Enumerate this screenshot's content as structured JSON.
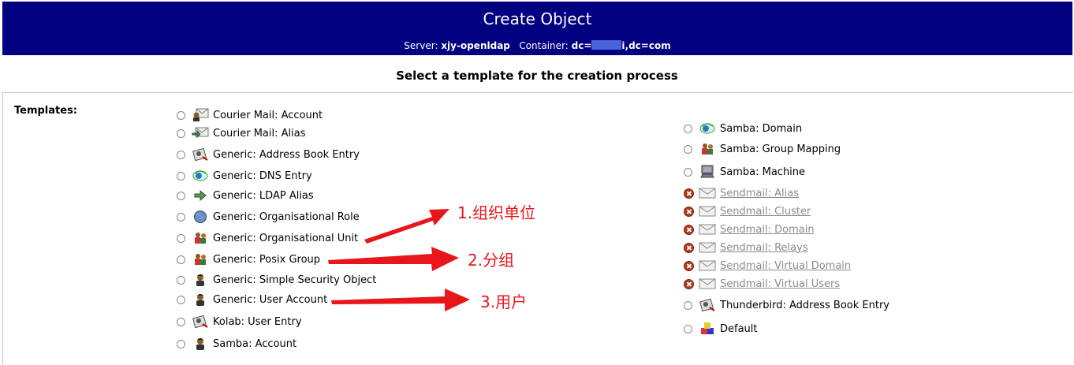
{
  "header": {
    "title": "Create Object",
    "server_label": "Server:",
    "server_value": "xjy-openldap",
    "container_label": "Container:",
    "container_prefix": "dc=",
    "container_suffix": "i,dc=com"
  },
  "subtitle": "Select a template for the creation process",
  "templates_label": "Templates:",
  "left_templates": [
    {
      "label": "Courier Mail: Account",
      "icon": "mail-user-icon",
      "state": "enabled"
    },
    {
      "label": "Courier Mail: Alias",
      "icon": "mail-forward-icon",
      "state": "enabled"
    },
    {
      "label": "Generic: Address Book Entry",
      "icon": "address-book-icon",
      "state": "enabled"
    },
    {
      "label": "Generic: DNS Entry",
      "icon": "dns-icon",
      "state": "enabled"
    },
    {
      "label": "Generic: LDAP Alias",
      "icon": "arrow-right-icon",
      "state": "enabled"
    },
    {
      "label": "Generic: Organisational Role",
      "icon": "globe-icon",
      "state": "enabled"
    },
    {
      "label": "Generic: Organisational Unit",
      "icon": "group-icon",
      "state": "enabled"
    },
    {
      "label": "Generic: Posix Group",
      "icon": "group-icon",
      "state": "enabled"
    },
    {
      "label": "Generic: Simple Security Object",
      "icon": "user-icon",
      "state": "enabled"
    },
    {
      "label": "Generic: User Account",
      "icon": "user-icon",
      "state": "enabled"
    },
    {
      "label": "Kolab: User Entry",
      "icon": "address-book-icon",
      "state": "enabled"
    },
    {
      "label": "Samba: Account",
      "icon": "user-icon",
      "state": "enabled"
    }
  ],
  "right_templates": [
    {
      "label": "Samba: Domain",
      "icon": "dns-icon",
      "state": "enabled"
    },
    {
      "label": "Samba: Group Mapping",
      "icon": "group-icon",
      "state": "enabled"
    },
    {
      "label": "Samba: Machine",
      "icon": "computer-icon",
      "state": "enabled"
    },
    {
      "label": "Sendmail: Alias",
      "icon": "envelope-icon",
      "state": "disabled"
    },
    {
      "label": "Sendmail: Cluster",
      "icon": "envelope-icon",
      "state": "disabled"
    },
    {
      "label": "Sendmail: Domain",
      "icon": "envelope-icon",
      "state": "disabled"
    },
    {
      "label": "Sendmail: Relays",
      "icon": "envelope-icon",
      "state": "disabled"
    },
    {
      "label": "Sendmail: Virtual Domain",
      "icon": "envelope-icon",
      "state": "disabled"
    },
    {
      "label": "Sendmail: Virtual Users",
      "icon": "envelope-icon",
      "state": "disabled"
    },
    {
      "label": "Thunderbird: Address Book Entry",
      "icon": "address-book-icon",
      "state": "enabled"
    },
    {
      "label": "Default",
      "icon": "default-object-icon",
      "state": "enabled"
    }
  ],
  "annotations": [
    "1.组织单位",
    "2.分组",
    "3.用户"
  ],
  "colors": {
    "header_bg": "#000080",
    "annotation": "#e8151b",
    "disabled_text": "#8a8a8a"
  }
}
